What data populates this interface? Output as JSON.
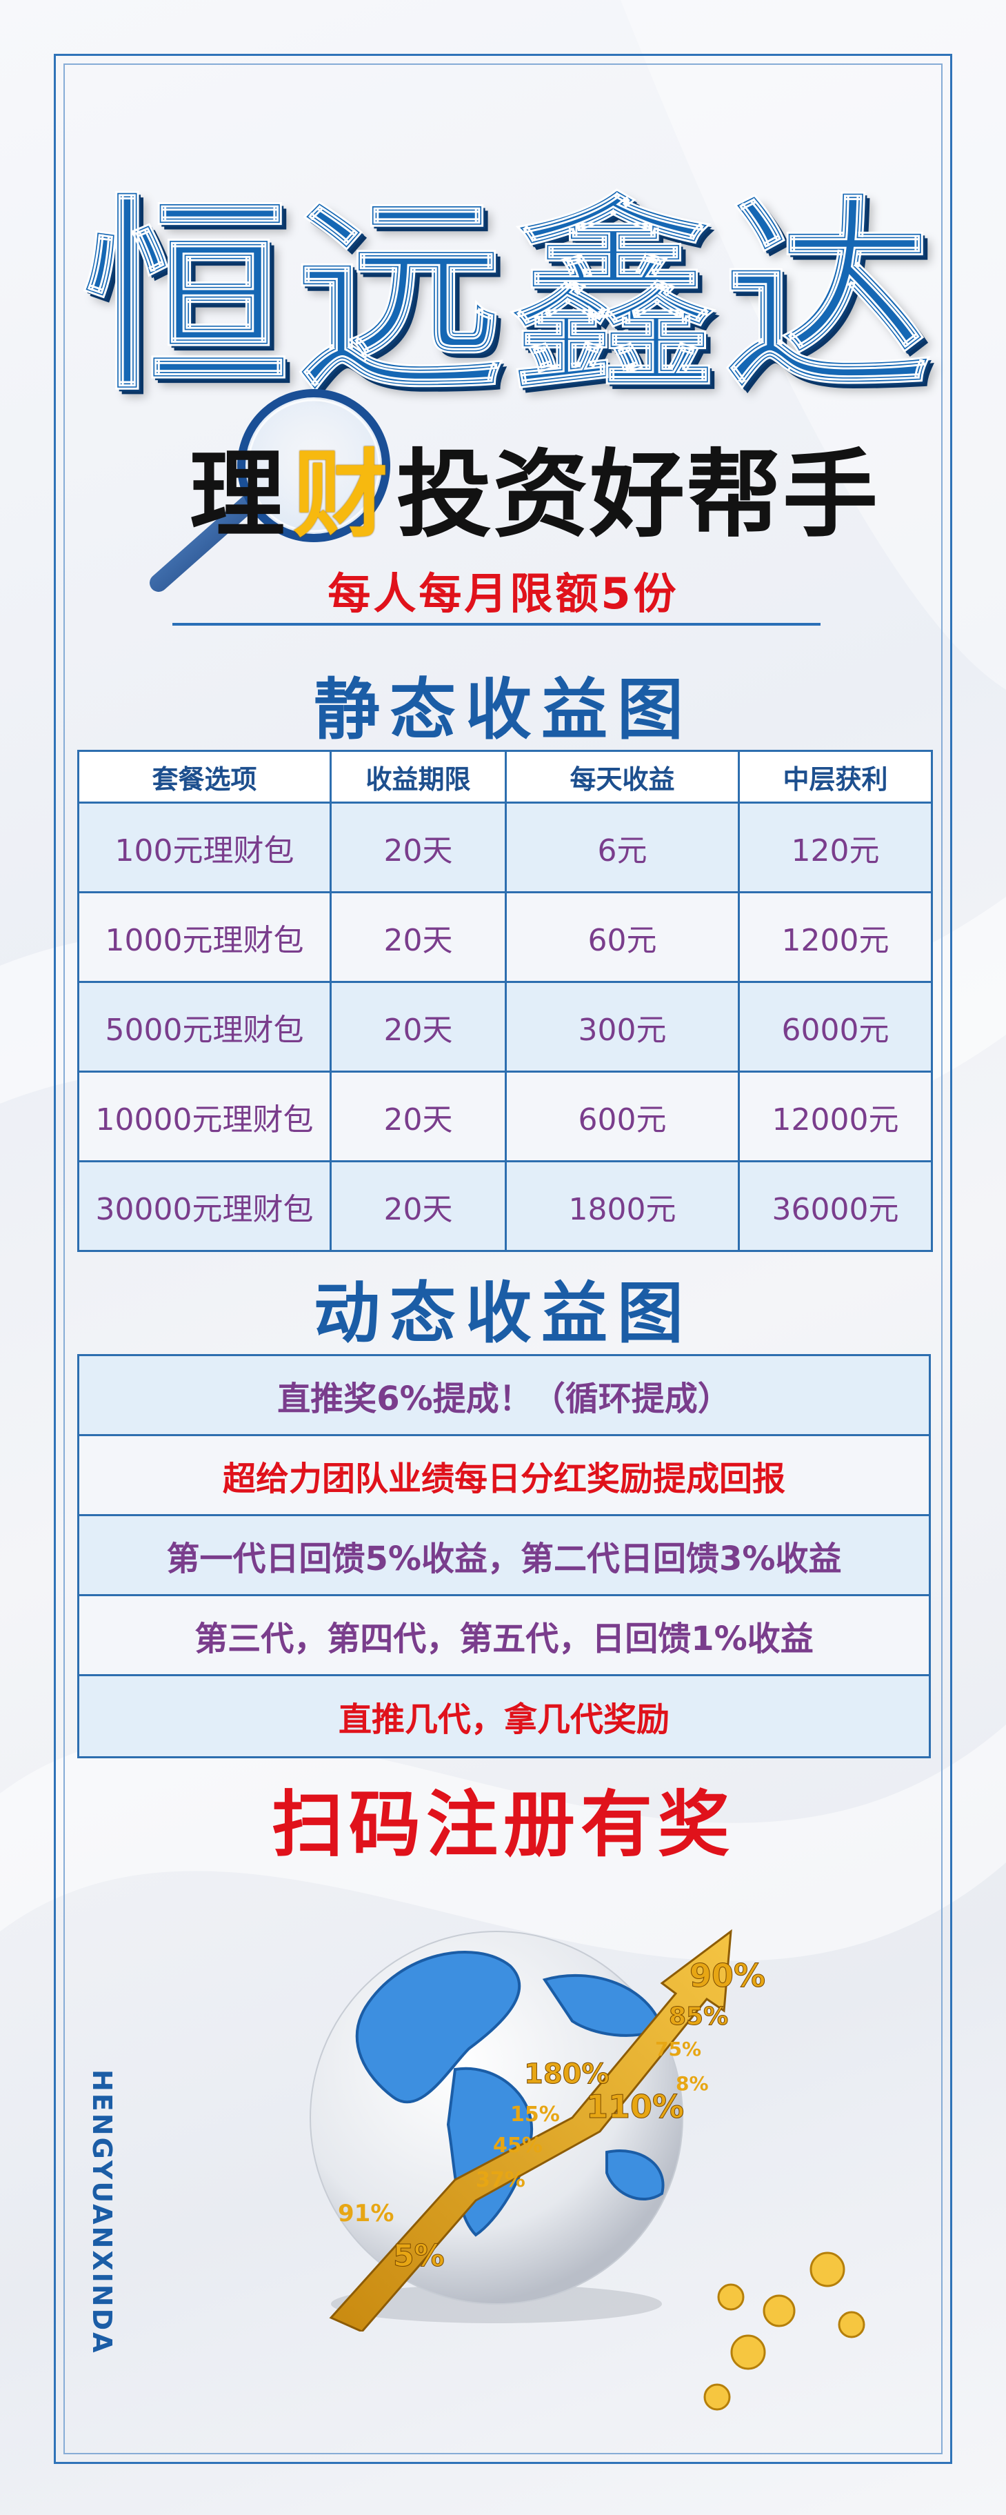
{
  "header": {
    "brand": "恒远鑫达",
    "slogan_prefix": "理",
    "slogan_accent": "财",
    "slogan_suffix": "投资好帮手",
    "limit_text": "每人每月限额5份"
  },
  "static_section": {
    "title": "静态收益图",
    "columns": [
      "套餐选项",
      "收益期限",
      "每天收益",
      "中层获利"
    ],
    "rows": [
      [
        "100元理财包",
        "20天",
        "6元",
        "120元"
      ],
      [
        "1000元理财包",
        "20天",
        "60元",
        "1200元"
      ],
      [
        "5000元理财包",
        "20天",
        "300元",
        "6000元"
      ],
      [
        "10000元理财包",
        "20天",
        "600元",
        "12000元"
      ],
      [
        "30000元理财包",
        "20天",
        "1800元",
        "36000元"
      ]
    ]
  },
  "dynamic_section": {
    "title": "动态收益图",
    "rows": [
      {
        "text": "直推奖6%提成！（循环提成）",
        "color": "#7a3d8c"
      },
      {
        "text": "超给力团队业绩每日分红奖励提成回报",
        "color": "#e0121b"
      },
      {
        "text": "第一代日回馈5%收益，第二代日回馈3%收益",
        "color": "#7a3d8c"
      },
      {
        "text": "第三代，第四代，第五代，日回馈1%收益",
        "color": "#7a3d8c"
      },
      {
        "text": "直推几代，拿几代奖励",
        "color": "#e0121b"
      }
    ]
  },
  "footer": {
    "cta": "扫码注册有奖",
    "vertical_brand": "HENGYUANXINDA"
  },
  "graphic_labels": [
    "90%",
    "85%",
    "75%",
    "180%",
    "110%",
    "15%",
    "45%",
    "37%",
    "91%",
    "5%",
    "8%"
  ],
  "colors": {
    "brand_blue": "#1567b4",
    "frame_blue": "#2f73b8",
    "accent_gold": "#f7b90f",
    "alert_red": "#e0121b",
    "cell_purple": "#7a3d8c"
  },
  "icons": [
    "magnifier-icon",
    "globe-icon",
    "growth-arrow-icon",
    "coin-icon"
  ]
}
